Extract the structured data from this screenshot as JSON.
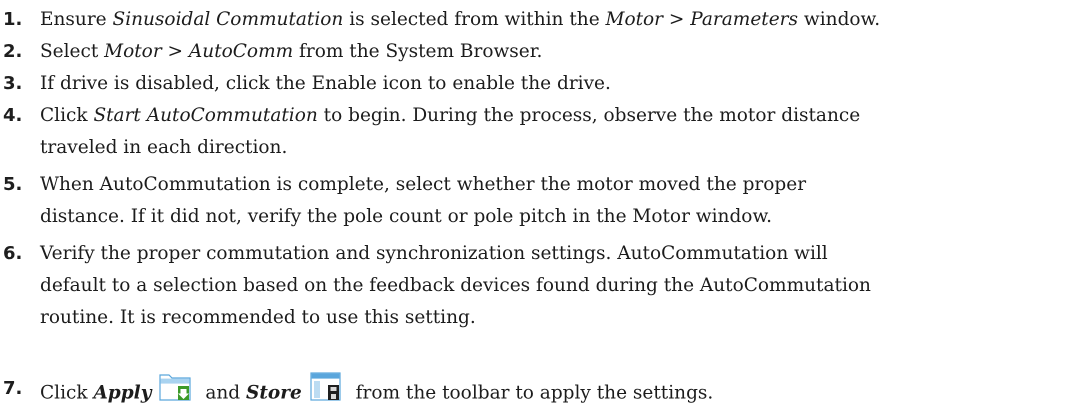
{
  "steps": [
    {
      "num": "1.",
      "line1": {
        "a": "Ensure ",
        "b": "Sinusoidal Commutation",
        "c": " is selected from within the ",
        "d": "Motor > Parameters",
        "e": " window."
      }
    },
    {
      "num": "2.",
      "line1": {
        "a": "Select ",
        "b": "Motor > AutoComm",
        "c": " from the System Browser."
      }
    },
    {
      "num": "3.",
      "line1": {
        "a": "If drive is disabled, click the Enable icon to enable the drive."
      }
    },
    {
      "num": "4.",
      "line1": {
        "a": "Click ",
        "b": "Start AutoCommutation",
        "c": " to begin. During the process, observe the motor distance"
      },
      "line2": "traveled in each direction."
    },
    {
      "num": "5.",
      "line1": {
        "a": "When AutoCommutation is complete, select whether the motor moved the proper"
      },
      "line2": "distance. If it did not, verify the pole count or pole pitch in the Motor window."
    },
    {
      "num": "6.",
      "line1": {
        "a": "Verify the proper commutation and synchronization settings. AutoCommutation will"
      },
      "line2": "default to a selection based on the feedback devices found during the AutoCommutation",
      "line3": "routine. It is recommended to use this setting."
    },
    {
      "num": "7.",
      "line1": {
        "a": "Click ",
        "b": "Apply",
        "c": " and ",
        "d": "Store",
        "e": " from the toolbar to apply the settings."
      },
      "icons": {
        "apply": "apply-folder-download-icon",
        "store": "store-window-save-icon"
      }
    }
  ],
  "colors": {
    "text": "#1c1c1c",
    "icon_blue": "#5aa6dc",
    "icon_green": "#3c9a2a"
  }
}
